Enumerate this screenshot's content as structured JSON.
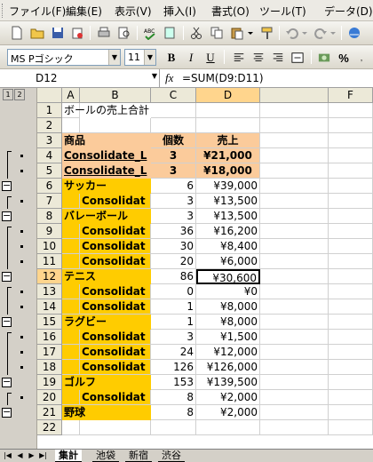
{
  "menu": [
    "ファイル(F)",
    "編集(E)",
    "表示(V)",
    "挿入(I)",
    "書式(O)",
    "ツール(T)",
    "データ(D)"
  ],
  "format_bar": {
    "font_name": "MS Pゴシック",
    "font_size": "11",
    "bold": "B",
    "italic": "I",
    "underline": "U",
    "currency": "%"
  },
  "formula_bar": {
    "name_box": "D12",
    "fx": "fx",
    "formula": "=SUM(D9:D11)"
  },
  "outline_levels": [
    "1",
    "2"
  ],
  "columns": [
    "A",
    "B",
    "C",
    "D",
    "F"
  ],
  "rows": [
    {
      "num": "1",
      "a": "ボールの売上合計",
      "b": "",
      "c": "",
      "d": ""
    },
    {
      "num": "2",
      "a": "",
      "b": "",
      "c": "",
      "d": ""
    },
    {
      "num": "3",
      "a": "商品",
      "b": "",
      "c": "個数",
      "d": "売上"
    },
    {
      "num": "4",
      "a": "Consolidate_L",
      "b": "",
      "c": "3",
      "d": "¥21,000"
    },
    {
      "num": "5",
      "a": "Consolidate_L",
      "b": "",
      "c": "3",
      "d": "¥18,000"
    },
    {
      "num": "6",
      "a": "サッカー",
      "b": "",
      "c": "6",
      "d": "¥39,000"
    },
    {
      "num": "7",
      "a": "",
      "b": "Consolidat",
      "c": "3",
      "d": "¥13,500"
    },
    {
      "num": "8",
      "a": "バレーボール",
      "b": "",
      "c": "3",
      "d": "¥13,500"
    },
    {
      "num": "9",
      "a": "",
      "b": "Consolidat",
      "c": "36",
      "d": "¥16,200"
    },
    {
      "num": "10",
      "a": "",
      "b": "Consolidat",
      "c": "30",
      "d": "¥8,400"
    },
    {
      "num": "11",
      "a": "",
      "b": "Consolidat",
      "c": "20",
      "d": "¥6,000"
    },
    {
      "num": "12",
      "a": "テニス",
      "b": "",
      "c": "86",
      "d": "¥30,600"
    },
    {
      "num": "13",
      "a": "",
      "b": "Consolidat",
      "c": "0",
      "d": "¥0"
    },
    {
      "num": "14",
      "a": "",
      "b": "Consolidat",
      "c": "1",
      "d": "¥8,000"
    },
    {
      "num": "15",
      "a": "ラグビー",
      "b": "",
      "c": "1",
      "d": "¥8,000"
    },
    {
      "num": "16",
      "a": "",
      "b": "Consolidat",
      "c": "3",
      "d": "¥1,500"
    },
    {
      "num": "17",
      "a": "",
      "b": "Consolidat",
      "c": "24",
      "d": "¥12,000"
    },
    {
      "num": "18",
      "a": "",
      "b": "Consolidat",
      "c": "126",
      "d": "¥126,000"
    },
    {
      "num": "19",
      "a": "ゴルフ",
      "b": "",
      "c": "153",
      "d": "¥139,500"
    },
    {
      "num": "20",
      "a": "",
      "b": "Consolidat",
      "c": "8",
      "d": "¥2,000"
    },
    {
      "num": "21",
      "a": "野球",
      "b": "",
      "c": "8",
      "d": "¥2,000"
    },
    {
      "num": "22",
      "a": "",
      "b": "",
      "c": "",
      "d": ""
    }
  ],
  "sheet_tabs": [
    "集計",
    "池袋",
    "新宿",
    "渋谷"
  ],
  "colors": {
    "header_orange": "#fbcb9b",
    "group_gold": "#ffcc00",
    "selection": "#ffd58d"
  }
}
